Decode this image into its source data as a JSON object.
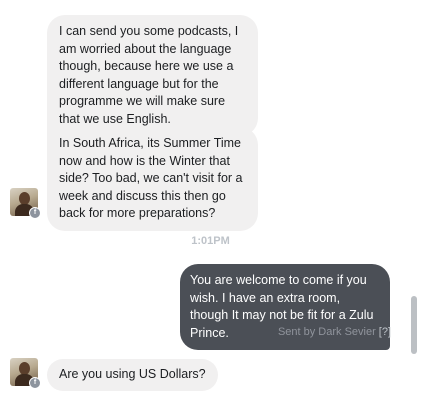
{
  "thread": {
    "messages": [
      {
        "sender": "other",
        "text": "I can send you some podcasts, I am worried about the language though, because here we use a different language but for the programme we will make sure that we use English."
      },
      {
        "sender": "other",
        "text": "In South Africa, its Summer Time now and how is the Winter that side? Too bad, we can't visit for a week and discuss this then go back for more preparations?"
      },
      {
        "sender": "me",
        "text": "You are welcome to come if you wish.  I have an extra room, though It may not be fit for a Zulu Prince."
      },
      {
        "sender": "other",
        "text": "Are you using US Dollars?"
      }
    ],
    "timestamp": "1:01PM",
    "sent_by_label": "Sent by Dark Sevier",
    "sent_by_help": "[?]",
    "badge_glyph": "f"
  },
  "colors": {
    "incoming_bubble": "#f1f0f0",
    "outgoing_bubble": "#4b4f56",
    "timestamp": "#bec3c9"
  }
}
